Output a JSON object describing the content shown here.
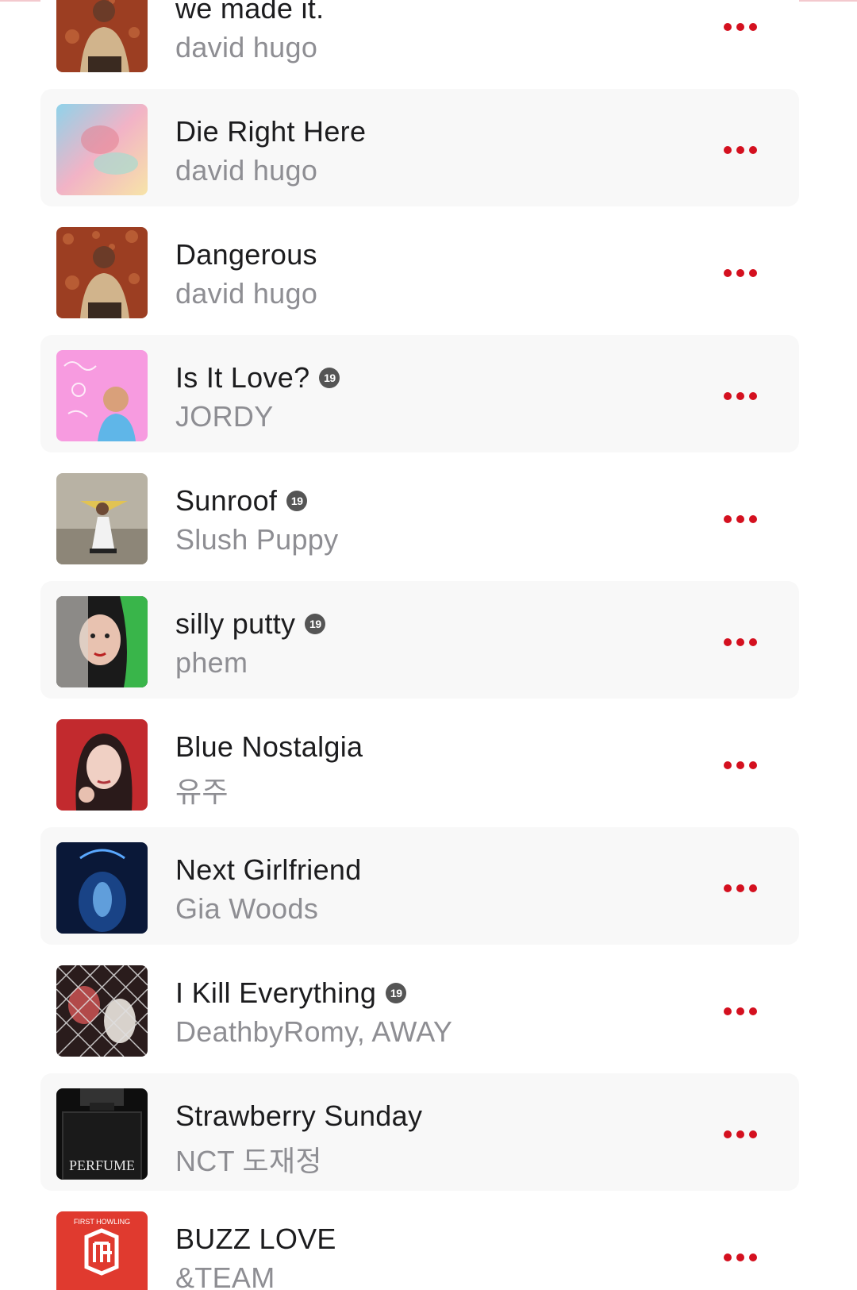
{
  "colors": {
    "accent": "#d4101f",
    "row_shade": "#f8f8f8",
    "title_text": "#1c1c1e",
    "artist_text": "#8e8e93",
    "badge": "#555555"
  },
  "tracks": [
    {
      "title": "we made it.",
      "artist": "david hugo",
      "explicit": false,
      "badge": "",
      "shaded": false,
      "artwork_icon": "album-art-man-red-pattern"
    },
    {
      "title": "Die Right Here",
      "artist": "david hugo",
      "explicit": false,
      "badge": "",
      "shaded": true,
      "artwork_icon": "album-art-pastel-cloud"
    },
    {
      "title": "Dangerous",
      "artist": "david hugo",
      "explicit": false,
      "badge": "",
      "shaded": false,
      "artwork_icon": "album-art-man-red-pattern"
    },
    {
      "title": "Is It Love?",
      "artist": "JORDY",
      "explicit": true,
      "badge": "19",
      "shaded": true,
      "artwork_icon": "album-art-pink-doodle"
    },
    {
      "title": "Sunroof",
      "artist": "Slush Puppy",
      "explicit": true,
      "badge": "19",
      "shaded": false,
      "artwork_icon": "album-art-street-photo"
    },
    {
      "title": "silly putty",
      "artist": "phem",
      "explicit": true,
      "badge": "19",
      "shaded": true,
      "artwork_icon": "album-art-green-hair-portrait"
    },
    {
      "title": "Blue Nostalgia",
      "artist": "유주",
      "explicit": false,
      "badge": "",
      "shaded": false,
      "artwork_icon": "album-art-red-portrait"
    },
    {
      "title": "Next Girlfriend",
      "artist": "Gia Woods",
      "explicit": false,
      "badge": "",
      "shaded": true,
      "artwork_icon": "album-art-blue-night"
    },
    {
      "title": "I Kill Everything",
      "artist": "DeathbyRomy, AWAY",
      "explicit": true,
      "badge": "19",
      "shaded": false,
      "artwork_icon": "album-art-chain-fence"
    },
    {
      "title": "Strawberry Sunday",
      "artist": "NCT 도재정",
      "explicit": false,
      "badge": "",
      "shaded": true,
      "artwork_icon": "album-art-perfume-bottle",
      "artwork_text": "PERFUME"
    },
    {
      "title": "BUZZ LOVE",
      "artist": "&TEAM",
      "explicit": false,
      "badge": "",
      "shaded": false,
      "artwork_icon": "album-art-red-logo",
      "artwork_text": "FIRST HOWLING"
    }
  ],
  "actions": {
    "more_icon": "more-options-icon"
  }
}
